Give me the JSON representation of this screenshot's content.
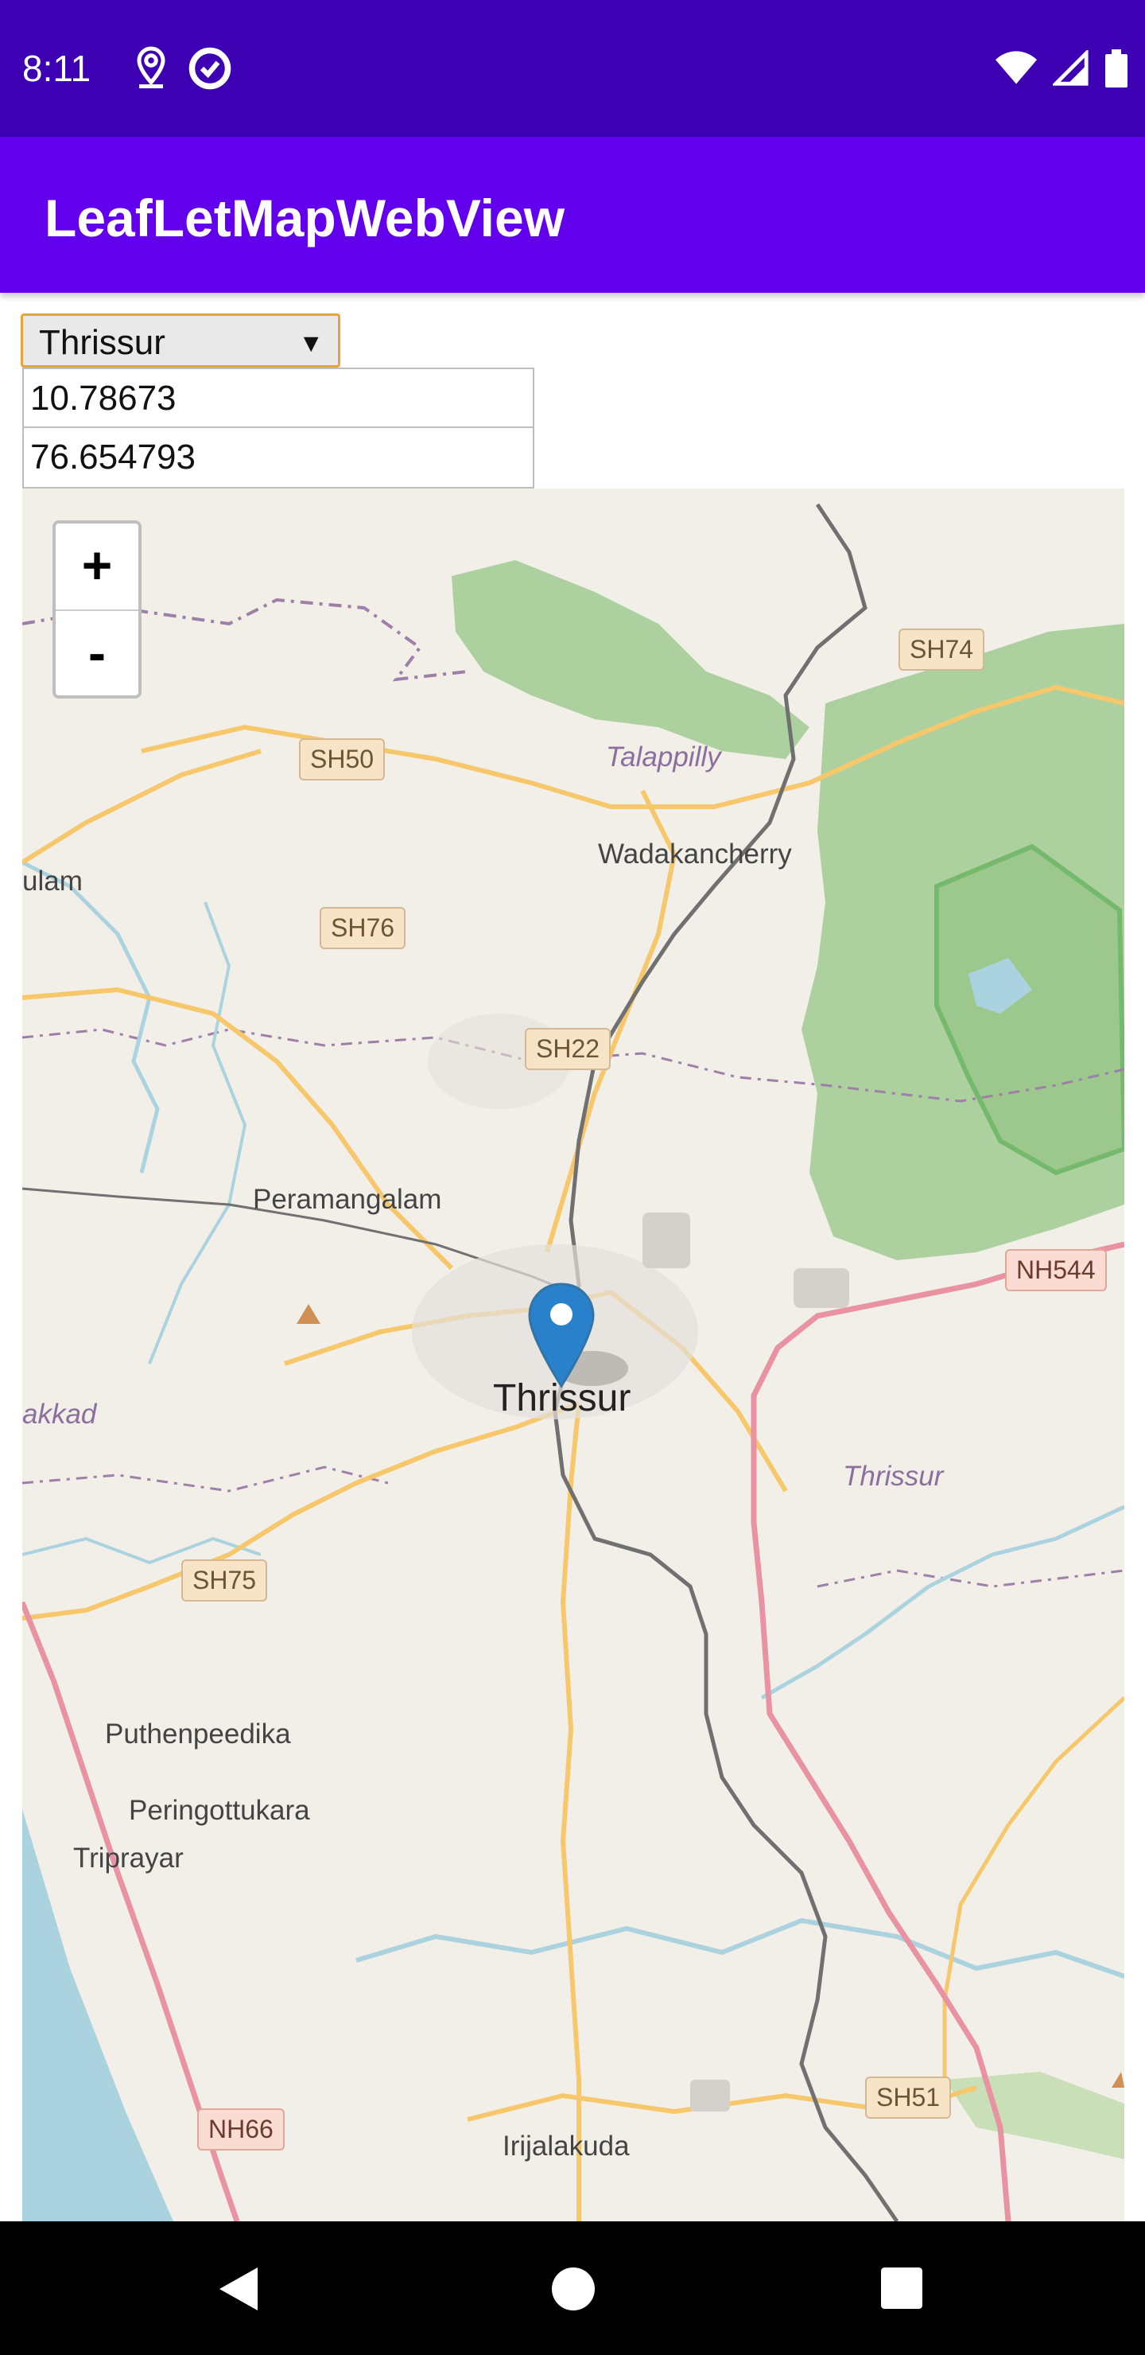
{
  "status_bar": {
    "time": "8:11",
    "icons": [
      "location-icon",
      "data-saver-icon",
      "wifi-icon",
      "signal-icon",
      "battery-icon"
    ]
  },
  "app_bar": {
    "title": "LeafLetMapWebView"
  },
  "controls": {
    "city_select": {
      "selected": "Thrissur",
      "arrow": "▼"
    },
    "latitude": "10.78673",
    "longitude": "76.654793"
  },
  "map": {
    "zoom_in": "+",
    "zoom_out": "-",
    "marker": {
      "place": "Thrissur",
      "lat": 10.78673,
      "lng": 76.654793
    },
    "places": {
      "talappilly": "Talappilly",
      "wadakancherry": "Wadakancherry",
      "ulam": "ulam",
      "peramangalam": "Peramangalam",
      "thrissur": "Thrissur",
      "thrissur_district": "Thrissur",
      "akkad": "akkad",
      "puthenpeedika": "Puthenpeedika",
      "peringottukara": "Peringottukara",
      "triprayar": "Triprayar",
      "irijalakuda": "Irijalakuda"
    },
    "roads": {
      "sh74": "SH74",
      "sh50": "SH50",
      "sh76": "SH76",
      "sh22": "SH22",
      "nh544": "NH544",
      "sh75": "SH75",
      "sh51": "SH51",
      "nh66": "NH66"
    },
    "colors": {
      "land": "#f2efe9",
      "forest": "#add19e",
      "water": "#aad3df",
      "major_road": "#e892a2",
      "secondary_road": "#f7c86b",
      "rail": "#707070",
      "boundary": "#9e7fa8",
      "marker": "#2a81cb"
    }
  },
  "nav_bar": {
    "buttons": [
      "back-icon",
      "home-icon",
      "recents-icon"
    ]
  },
  "theme": {
    "status_bar": "#3d00b3",
    "app_bar": "#6200ee"
  }
}
